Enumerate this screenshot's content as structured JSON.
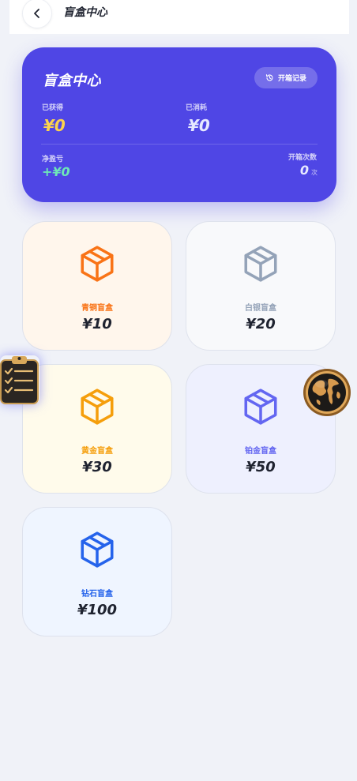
{
  "header": {
    "title": "盲盒中心",
    "back_icon": "chevron-left-icon"
  },
  "summary": {
    "title": "盲盒中心",
    "history_button_label": "开箱记录",
    "obtained_label": "已获得",
    "obtained_value": "¥0",
    "spent_label": "已消耗",
    "spent_value": "¥0",
    "net_label": "净盈亏",
    "net_value": "+¥0",
    "open_count_label": "开箱次数",
    "open_count_value": "0",
    "open_count_unit": "次"
  },
  "boxes": [
    {
      "name": "青铜盲盒",
      "price": "¥10",
      "color": "#f97316",
      "bg": "#fff6ec"
    },
    {
      "name": "白银盲盒",
      "price": "¥20",
      "color": "#94a3b8",
      "bg": "#f8f9fb"
    },
    {
      "name": "黄金盲盒",
      "price": "¥30",
      "color": "#f59e0b",
      "bg": "#fffbeb"
    },
    {
      "name": "铂金盲盒",
      "price": "¥50",
      "color": "#6366f1",
      "bg": "#eef0fe"
    },
    {
      "name": "钻石盲盒",
      "price": "¥100",
      "color": "#2563eb",
      "bg": "#eff5ff"
    }
  ],
  "floating": {
    "clipboard_icon": "clipboard-checklist-icon",
    "globe_icon": "globe-icon"
  },
  "colors": {
    "accent": "#4f46e5",
    "obtained": "#fcd34d",
    "net": "#6ee7b7",
    "page_bg": "#f0f2f8"
  }
}
